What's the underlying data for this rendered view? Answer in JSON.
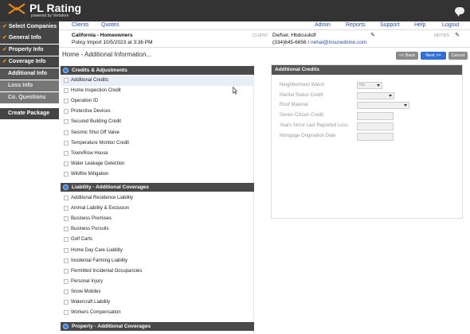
{
  "app": {
    "logo_text": "PL Rating",
    "logo_sub": "powered by Vertafore"
  },
  "sidebar": {
    "items": [
      {
        "label": "Select Companies",
        "state": "done"
      },
      {
        "label": "General Info",
        "state": "done"
      },
      {
        "label": "Property Info",
        "state": "done"
      },
      {
        "label": "Coverage Info",
        "state": "done"
      },
      {
        "label": "Additional Info",
        "state": "current"
      },
      {
        "label": "Loss Info",
        "state": "sub"
      },
      {
        "label": "Co. Questions",
        "state": "sub"
      },
      {
        "label": "Create Package",
        "state": "package"
      }
    ]
  },
  "nav": {
    "clients": "Clients",
    "quotes": "Quotes",
    "admin": "Admin",
    "reports": "Reports",
    "support": "Support",
    "help": "Help",
    "logout": "Logout"
  },
  "policy": {
    "title": "California - Homeowners",
    "import": "Policy Import 10/5/2023 at 3:36 PM"
  },
  "client": {
    "label": "CLIENT",
    "name": "Dwfser, Hbdcuukdf",
    "phone": "(334)645-6656 /",
    "email": "nehal@insurednine.com"
  },
  "notes": {
    "label": "NOTES"
  },
  "page": {
    "title": "Home - Additional Information..."
  },
  "buttons": {
    "back": "<< Back",
    "next": "Next >>",
    "cancel": "Cancel"
  },
  "colors": {
    "check": "#f08a1c",
    "link": "#2a4ea0",
    "next_btn": "#2f6fd6",
    "section_bg": "#4a4a4a"
  },
  "sections": {
    "credits": {
      "title": "Credits & Adjustments",
      "items": [
        "Additional Credits",
        "Home Inspection Credit",
        "Operation ID",
        "Protective Devices",
        "Secured Building Credit",
        "Seismic Shut Off Valve",
        "Temperature Monitor Credit",
        "Town/Row House",
        "Water Leakage Detection",
        "Wildfire Mitigation"
      ]
    },
    "liability": {
      "title": "Liability - Additional Coverages",
      "items": [
        "Additional Residence Liability",
        "Animal Liability & Exclusion",
        "Business Premises",
        "Business Pursuits",
        "Golf Carts",
        "Home Day Care Liability",
        "Incidental Farming Liability",
        "Permitted Incidental Occupancies",
        "Personal Injury",
        "Snow Mobiles",
        "Watercraft Liability",
        "Workers Compensation"
      ]
    },
    "property": {
      "title": "Property - Additional Coverages"
    }
  },
  "additional_credits": {
    "title": "Additional Credits",
    "fields": [
      {
        "label": "Neighborhood Watch",
        "value": "No"
      },
      {
        "label": "Marital Status Credit",
        "value": ""
      },
      {
        "label": "Roof Material",
        "value": ""
      },
      {
        "label": "Senior Citizen Credit",
        "value": ""
      },
      {
        "label": "Years Since Last Reported Loss",
        "value": ""
      },
      {
        "label": "Mortgage Origination Date",
        "value": ""
      }
    ]
  }
}
